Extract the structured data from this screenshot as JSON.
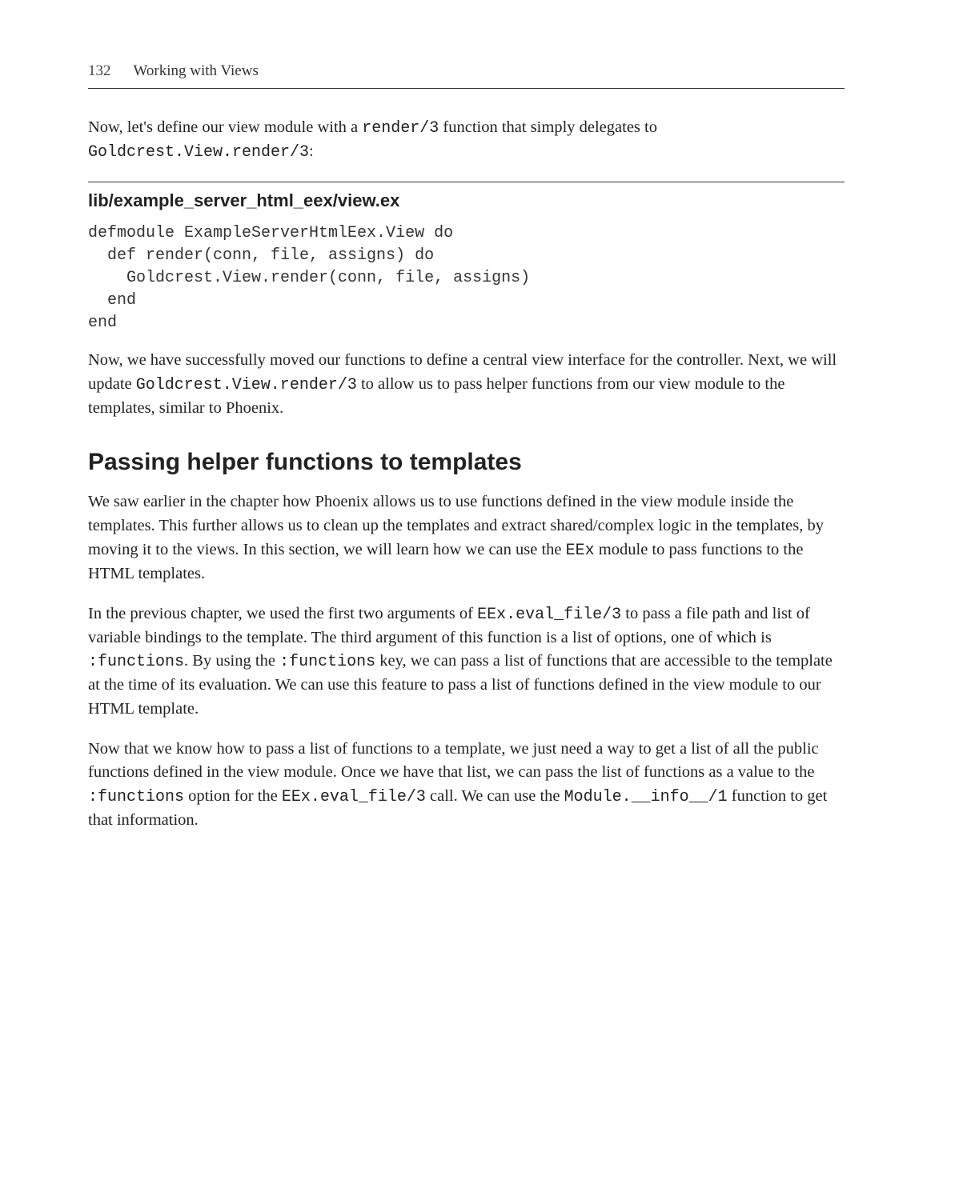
{
  "page": {
    "number": "132",
    "running_title": "Working with Views"
  },
  "para1": {
    "t1": "Now, let's define our view module with a ",
    "c1": "render/3",
    "t2": " function that simply delegates to ",
    "c2": "Goldcrest.View.render/3",
    "t3": ":"
  },
  "file_heading": "lib/example_server_html_eex/view.ex",
  "code1": "defmodule ExampleServerHtmlEex.View do\n  def render(conn, file, assigns) do\n    Goldcrest.View.render(conn, file, assigns)\n  end\nend",
  "para2": {
    "t1": "Now, we have successfully moved our functions to define a central view interface for the controller. Next, we will update ",
    "c1": "Goldcrest.View.render/3",
    "t2": " to allow us to pass helper functions from our view module to the templates, similar to Phoenix."
  },
  "section_heading": "Passing helper functions to templates",
  "para3": {
    "t1": "We saw earlier in the chapter how Phoenix allows us to use functions defined in the view module inside the templates. This further allows us to clean up the templates and extract shared/complex logic in the templates, by moving it to the views. In this section, we will learn how we can use the ",
    "c1": "EEx",
    "t2": " module to pass functions to the HTML templates."
  },
  "para4": {
    "t1": "In the previous chapter, we used the first two arguments of ",
    "c1": "EEx.eval_file/3",
    "t2": " to pass a file path and list of variable bindings to the template. The third argument of this function is a list of options, one of which is ",
    "c2": ":functions",
    "t3": ". By using the ",
    "c3": ":functions",
    "t4": " key, we can pass a list of functions that are accessible to the template at the time of its evaluation. We can use this feature to pass a list of functions defined in the view module to our HTML template."
  },
  "para5": {
    "t1": "Now that we know how to pass a list of functions to a template, we just need a way to get a list of all the public functions defined in the view module. Once we have that list, we can pass the list of functions as a value to the ",
    "c1": ":functions",
    "t2": " option for the ",
    "c2": "EEx.eval_file/3",
    "t3": " call. We can use the ",
    "c3": "Module.__info__/1",
    "t4": " function to get that information."
  }
}
